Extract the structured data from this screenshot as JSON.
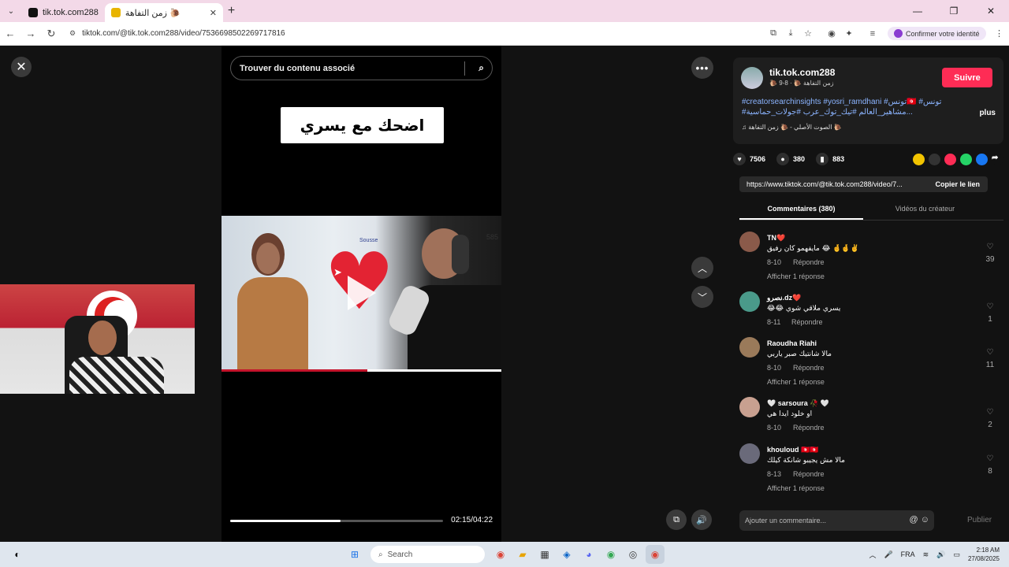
{
  "browser": {
    "tabs": [
      {
        "label": "tik.tok.com288"
      },
      {
        "label": "زمن التفاهة 🐌"
      }
    ],
    "url": "tiktok.com/@tik.tok.com288/video/7536698502269717816",
    "profile_label": "Confirmer votre identité"
  },
  "viewer": {
    "search_placeholder": "Trouver du contenu associé",
    "video_title": "اضحك مع يسري",
    "frame_number": "585",
    "time": "02:15/04:22",
    "progress_fraction": 0.52
  },
  "author": {
    "username": "tik.tok.com288",
    "nickname": "🐌 زمن التفاهة 🐌 · 8-9",
    "follow_label": "Suivre",
    "description_line1": "#creatorsearchinsights #yosri_ramdhani #تونس🇹🇳 #تونس",
    "description_line2": "#مشاهير_العالم #تيك_توك_عرب #جولات_حماسية...",
    "more_label": "plus",
    "music": "♫ الصوت الأصلي - 🐌 زمن التفاهة 🐌"
  },
  "stats": {
    "likes": "7506",
    "comments": "380",
    "saves": "883"
  },
  "share": {
    "link": "https://www.tiktok.com/@tik.tok.com288/video/7...",
    "copy_label": "Copier le lien"
  },
  "tabs": {
    "comments": "Commentaires (380)",
    "creator_videos": "Vidéos du créateur"
  },
  "comments": [
    {
      "name": "TN❤️",
      "text": "مايفهمو كان رفيق 😂 🤞🤞✌️",
      "date": "8-10",
      "reply": "Répondre",
      "likes": "39",
      "replies": "Afficher 1 réponse"
    },
    {
      "name": "نصرو.dz❤️",
      "text": "😂😂 يسري ملاقي شوي",
      "date": "8-11",
      "reply": "Répondre",
      "likes": "1",
      "replies": ""
    },
    {
      "name": "Raoudha Riahi",
      "text": "مالا شانتيك صبر ياربي",
      "date": "8-10",
      "reply": "Répondre",
      "likes": "11",
      "replies": "Afficher 1 réponse"
    },
    {
      "name": "🤍 sarsoura 🥀 🤍",
      "text": "او خلود ايدا هي",
      "date": "8-10",
      "reply": "Répondre",
      "likes": "2",
      "replies": ""
    },
    {
      "name": "khouloud 🇹🇳🇹🇳",
      "text": "مالا مش يجيبو شانكة كيلك",
      "date": "8-13",
      "reply": "Répondre",
      "likes": "8",
      "replies": "Afficher 1 réponse"
    }
  ],
  "composer": {
    "placeholder": "Ajouter un commentaire...",
    "publish_label": "Publier"
  },
  "taskbar": {
    "search_label": "Search",
    "lang": "FRA",
    "time": "2:18 AM",
    "date": "27/08/2025"
  },
  "colors": {
    "accent": "#fe2c55",
    "hashtag": "#8bb4ff"
  }
}
